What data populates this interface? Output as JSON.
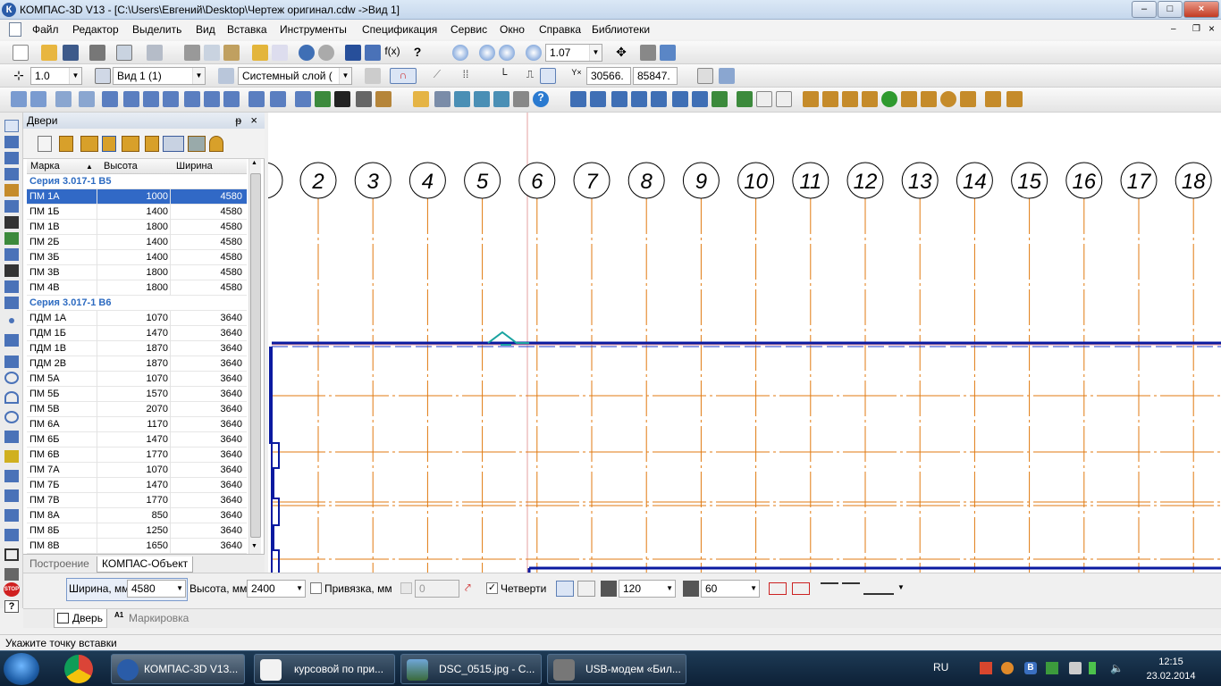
{
  "window": {
    "title": "КОМПАС-3D V13 - [C:\\Users\\Евгений\\Desktop\\Чертеж оригинал.cdw ->Вид 1]",
    "minimize_glyph": "–",
    "maximize_glyph": "□",
    "close_glyph": "×"
  },
  "menu": {
    "items": [
      "Файл",
      "Редактор",
      "Выделить",
      "Вид",
      "Вставка",
      "Инструменты",
      "Спецификация",
      "Сервис",
      "Окно",
      "Справка",
      "Библиотеки"
    ]
  },
  "toolbar1": {
    "zoom_value": "1.07"
  },
  "toolbar2": {
    "step_value": "1.0",
    "view_value": "Вид 1 (1)",
    "layer_value": "Системный слой (",
    "coord_x": "30566.",
    "coord_y": "85847."
  },
  "panel": {
    "title": "Двери",
    "pin_glyph": "ᵽ",
    "close_glyph": "×",
    "columns": [
      "Марка",
      "Высота",
      "Ширина"
    ],
    "sort_indicator": "▲",
    "rows": [
      {
        "type": "group",
        "label": "Серия 3.017-1 В5"
      },
      {
        "type": "item",
        "mark": "ПМ 1А",
        "height": "1000",
        "width": "4580",
        "selected": true
      },
      {
        "type": "item",
        "mark": "ПМ 1Б",
        "height": "1400",
        "width": "4580"
      },
      {
        "type": "item",
        "mark": "ПМ 1В",
        "height": "1800",
        "width": "4580"
      },
      {
        "type": "item",
        "mark": "ПМ 2Б",
        "height": "1400",
        "width": "4580"
      },
      {
        "type": "item",
        "mark": "ПМ 3Б",
        "height": "1400",
        "width": "4580"
      },
      {
        "type": "item",
        "mark": "ПМ 3В",
        "height": "1800",
        "width": "4580"
      },
      {
        "type": "item",
        "mark": "ПМ 4В",
        "height": "1800",
        "width": "4580"
      },
      {
        "type": "group",
        "label": "Серия 3.017-1 В6"
      },
      {
        "type": "item",
        "mark": "ПДМ 1А",
        "height": "1070",
        "width": "3640"
      },
      {
        "type": "item",
        "mark": "ПДМ 1Б",
        "height": "1470",
        "width": "3640"
      },
      {
        "type": "item",
        "mark": "ПДМ 1В",
        "height": "1870",
        "width": "3640"
      },
      {
        "type": "item",
        "mark": "ПДМ 2В",
        "height": "1870",
        "width": "3640"
      },
      {
        "type": "item",
        "mark": "ПМ 5А",
        "height": "1070",
        "width": "3640"
      },
      {
        "type": "item",
        "mark": "ПМ 5Б",
        "height": "1570",
        "width": "3640"
      },
      {
        "type": "item",
        "mark": "ПМ 5В",
        "height": "2070",
        "width": "3640"
      },
      {
        "type": "item",
        "mark": "ПМ 6А",
        "height": "1170",
        "width": "3640"
      },
      {
        "type": "item",
        "mark": "ПМ 6Б",
        "height": "1470",
        "width": "3640"
      },
      {
        "type": "item",
        "mark": "ПМ 6В",
        "height": "1770",
        "width": "3640"
      },
      {
        "type": "item",
        "mark": "ПМ 7А",
        "height": "1070",
        "width": "3640"
      },
      {
        "type": "item",
        "mark": "ПМ 7Б",
        "height": "1470",
        "width": "3640"
      },
      {
        "type": "item",
        "mark": "ПМ 7В",
        "height": "1770",
        "width": "3640"
      },
      {
        "type": "item",
        "mark": "ПМ 8А",
        "height": "850",
        "width": "3640"
      },
      {
        "type": "item",
        "mark": "ПМ 8Б",
        "height": "1250",
        "width": "3640"
      },
      {
        "type": "item",
        "mark": "ПМ 8В",
        "height": "1650",
        "width": "3640"
      }
    ],
    "tabs": [
      "Построение",
      "КОМПАС-Объект"
    ]
  },
  "drawing": {
    "axis_labels": [
      "2",
      "3",
      "4",
      "5",
      "6",
      "7",
      "8",
      "9",
      "10",
      "11",
      "12",
      "13",
      "14",
      "15",
      "16",
      "17",
      "18"
    ],
    "axis_color": "#e07a10",
    "wall_color": "#0a1aa0"
  },
  "properties": {
    "width_label": "Ширина, мм",
    "width_value": "4580",
    "height_label": "Высота, мм",
    "height_value": "2400",
    "snap_label": "Привязка, мм",
    "snap_value": "0",
    "quarters_label": "Четверти",
    "quarter_value_1": "120",
    "quarter_value_2": "60",
    "tabs": [
      "Дверь",
      "Маркировка"
    ],
    "stop_label": "STOP",
    "help_glyph": "?"
  },
  "status": {
    "text": "Укажите точку вставки"
  },
  "taskbar": {
    "items": [
      {
        "label": "КОМПАС-3D V13..."
      },
      {
        "label": "курсовой по при..."
      },
      {
        "label": "DSC_0515.jpg - С..."
      },
      {
        "label": "USB-модем «Бил..."
      }
    ],
    "language": "RU",
    "time": "12:15",
    "date": "23.02.2014"
  }
}
